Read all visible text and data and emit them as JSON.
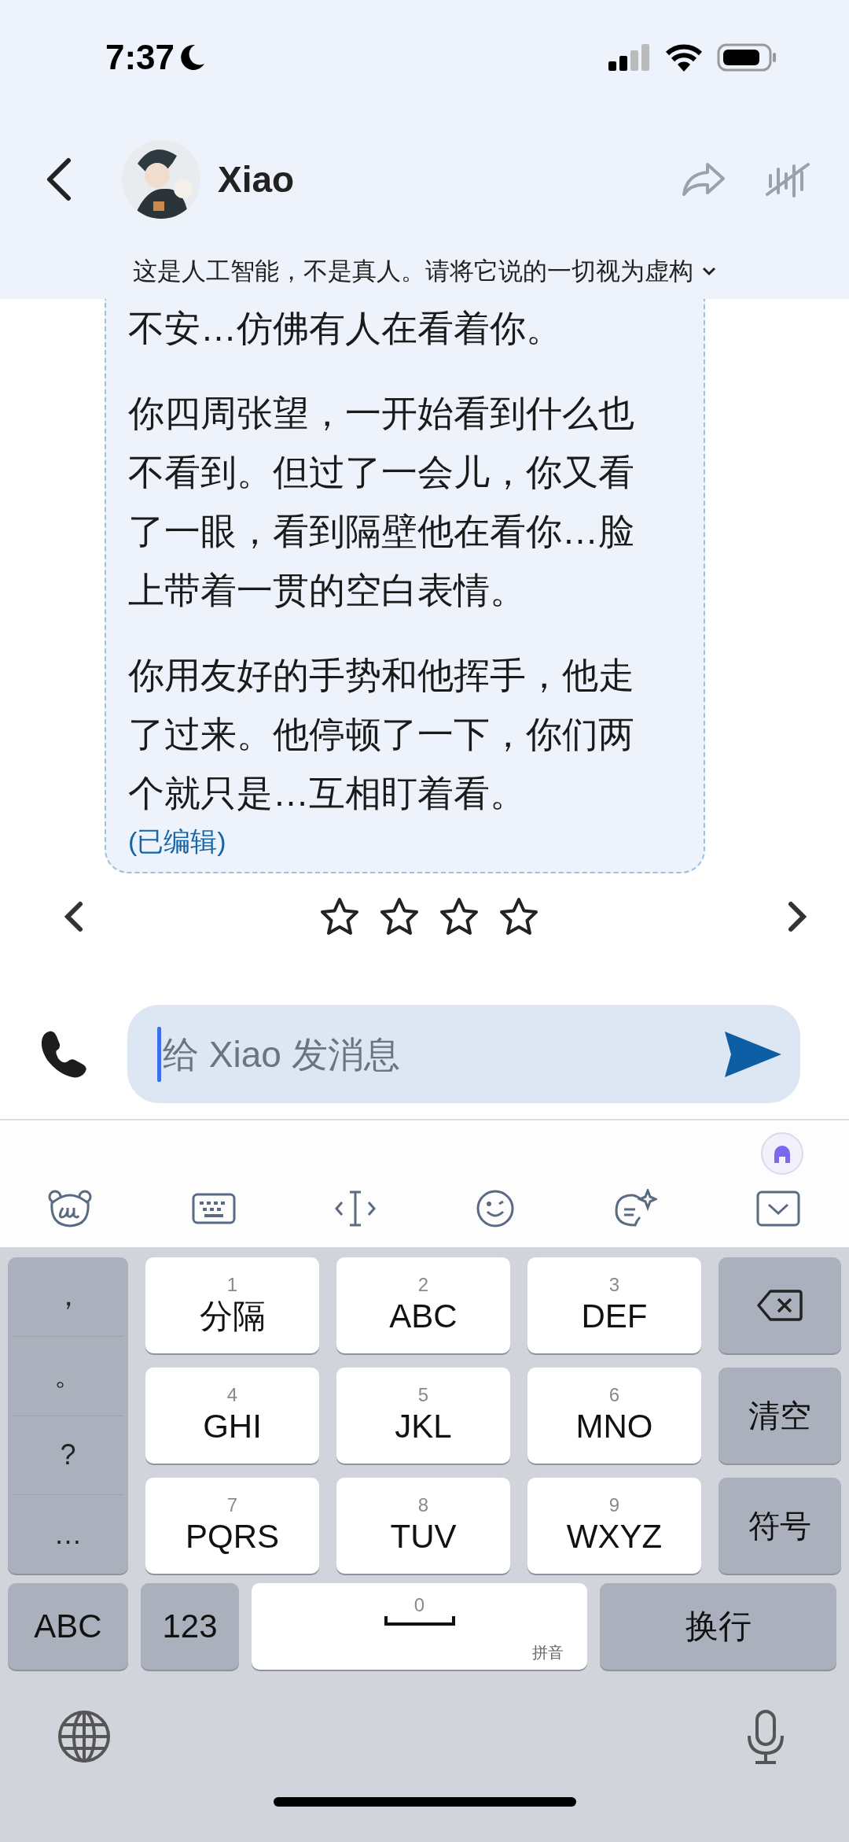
{
  "status_bar": {
    "time": "7:37"
  },
  "header": {
    "name": "Xiao",
    "disclaimer": "这是人工智能，不是真人。请将它说的一切视为虚构"
  },
  "message": {
    "paragraphs": [
      "不安…仿佛有人在看着你。",
      "你四周张望，一开始看到什么也不看到。但过了一会儿，你又看了一眼，看到隔壁他在看你…脸上带着一贯的空白表情。",
      "你用友好的手势和他挥手，他走了过来。他停顿了一下，你们两个就只是…互相盯着看。"
    ],
    "edited": "(已编辑)"
  },
  "rating": {
    "stars": 0
  },
  "composer": {
    "placeholder": "给 Xiao 发消息"
  },
  "keyboard": {
    "punctuation": [
      "，",
      "。",
      "?",
      "…"
    ],
    "keys": [
      {
        "number": "1",
        "label": "分隔"
      },
      {
        "number": "2",
        "label": "ABC"
      },
      {
        "number": "3",
        "label": "DEF"
      },
      {
        "number": "4",
        "label": "GHI"
      },
      {
        "number": "5",
        "label": "JKL"
      },
      {
        "number": "6",
        "label": "MNO"
      },
      {
        "number": "7",
        "label": "PQRS"
      },
      {
        "number": "8",
        "label": "TUV"
      },
      {
        "number": "9",
        "label": "WXYZ"
      }
    ],
    "side_keys": [
      {
        "kind": "delete"
      },
      {
        "kind": "text",
        "label": "清空"
      },
      {
        "kind": "text",
        "label": "符号"
      }
    ],
    "bottom_keys": [
      {
        "kind": "text",
        "label": "ABC"
      },
      {
        "kind": "text",
        "label": "123"
      },
      {
        "kind": "space",
        "number": "0",
        "hint": "拼音"
      },
      {
        "kind": "text",
        "label": "换行"
      }
    ]
  }
}
